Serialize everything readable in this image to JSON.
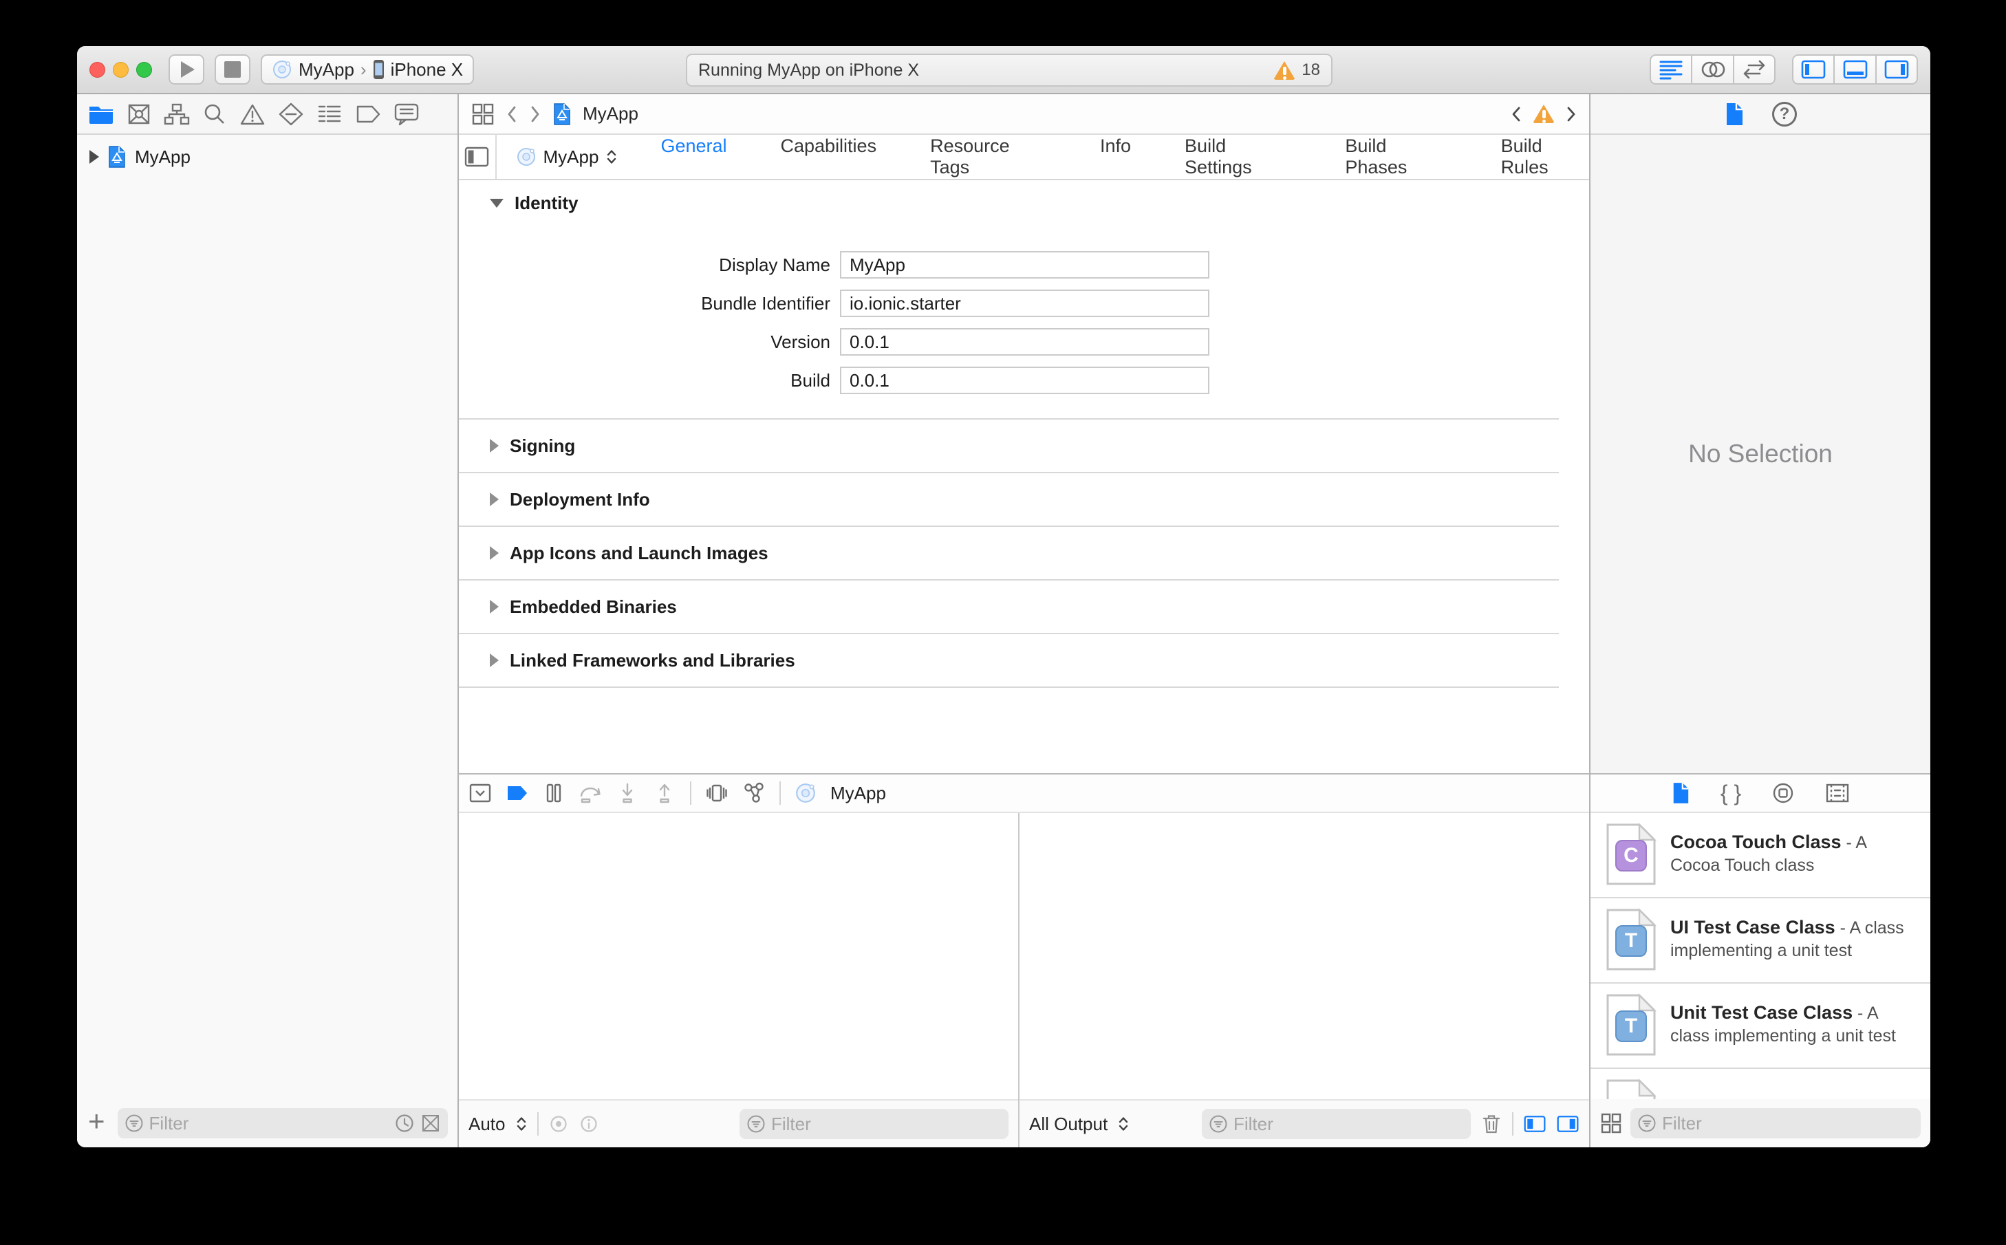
{
  "colors": {
    "accent": "#157EFB",
    "warning": "#F2A33C",
    "traffic_red": "#FC615D",
    "traffic_yellow": "#FDBC40",
    "traffic_green": "#34C84A",
    "badge_purple": "#B591DE",
    "badge_blue": "#7FB0DF"
  },
  "icons": {
    "scheme_separator": "›",
    "back_chevron": "‹",
    "forward_chevron": "›",
    "plus": "+",
    "help": "?",
    "braces": "{ }"
  },
  "toolbar": {
    "scheme_app": "MyApp",
    "scheme_device": "iPhone X",
    "status_text": "Running MyApp on iPhone X",
    "warning_count": "18"
  },
  "navigator": {
    "project": "MyApp",
    "filter_placeholder": "Filter"
  },
  "jumpbar": {
    "file": "MyApp"
  },
  "editor": {
    "target": "MyApp",
    "tabs": [
      {
        "label": "General",
        "active": true
      },
      {
        "label": "Capabilities",
        "active": false
      },
      {
        "label": "Resource Tags",
        "active": false
      },
      {
        "label": "Info",
        "active": false
      },
      {
        "label": "Build Settings",
        "active": false
      },
      {
        "label": "Build Phases",
        "active": false
      },
      {
        "label": "Build Rules",
        "active": false
      }
    ],
    "identity": {
      "title": "Identity",
      "fields": [
        {
          "label": "Display Name",
          "value": "MyApp"
        },
        {
          "label": "Bundle Identifier",
          "value": "io.ionic.starter"
        },
        {
          "label": "Version",
          "value": "0.0.1"
        },
        {
          "label": "Build",
          "value": "0.0.1"
        }
      ]
    },
    "sections": [
      "Signing",
      "Deployment Info",
      "App Icons and Launch Images",
      "Embedded Binaries",
      "Linked Frameworks and Libraries"
    ]
  },
  "debug": {
    "target": "MyApp",
    "variables_scope": "Auto",
    "variables_filter_placeholder": "Filter",
    "console_scope": "All Output",
    "console_filter_placeholder": "Filter"
  },
  "inspector": {
    "empty_text": "No Selection",
    "library": {
      "items": [
        {
          "badge": "C",
          "name": "Cocoa Touch Class",
          "desc": " - A Cocoa Touch class"
        },
        {
          "badge": "T",
          "name": "UI Test Case Class",
          "desc": " - A class implementing a unit test"
        },
        {
          "badge": "T",
          "name": "Unit Test Case Class",
          "desc": " - A class implementing a unit test"
        }
      ],
      "filter_placeholder": "Filter"
    }
  }
}
